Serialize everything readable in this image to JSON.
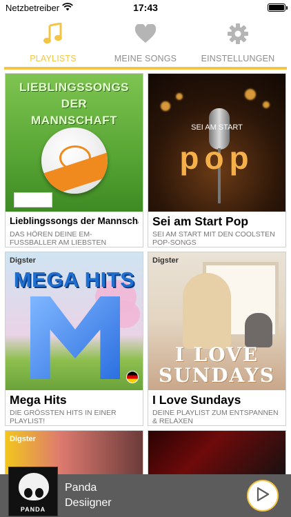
{
  "status_bar": {
    "carrier": "Netzbetreiber",
    "time": "17:43",
    "wifi_icon": "wifi-icon",
    "battery_level": 1.0
  },
  "tabs": [
    {
      "label": "PLAYLISTS",
      "icon": "music-note-icon",
      "active": true
    },
    {
      "label": "MEINE SONGS",
      "icon": "heart-icon",
      "active": false
    },
    {
      "label": "EINSTELLUNGEN",
      "icon": "gear-icon",
      "active": false
    }
  ],
  "colors": {
    "accent": "#f3c545",
    "inactive": "#b5b5b5",
    "player_bg": "#5c5c5c"
  },
  "playlists": [
    {
      "title": "Lieblingssongs der Mannschaft",
      "description": "Das Hören deine EM-Fussballer am liebsten",
      "art_lines": [
        "LIEBLINGSSONGS",
        "DER",
        "MANNSCHAFT"
      ]
    },
    {
      "title": "Sei am Start Pop",
      "description": "Sei am Start mit den coolsten Pop-Songs",
      "art_sub": "SEI AM START",
      "art_word": "pop"
    },
    {
      "title": "Mega Hits",
      "description": "Die grössten Hits in einer Playlist!",
      "brand": "Digster",
      "art_title": "MEGA HITS"
    },
    {
      "title": "I Love Sundays",
      "description": "Deine Playlist zum Entspannen & relaxen",
      "brand": "Digster",
      "art_lines": [
        "I LOVE",
        "SUNDAYS"
      ]
    },
    {
      "brand": "Digster"
    },
    {}
  ],
  "now_playing": {
    "title": "Panda",
    "artist": "Desiigner",
    "artwork_text": "PANDA",
    "play_icon": "play-icon"
  }
}
